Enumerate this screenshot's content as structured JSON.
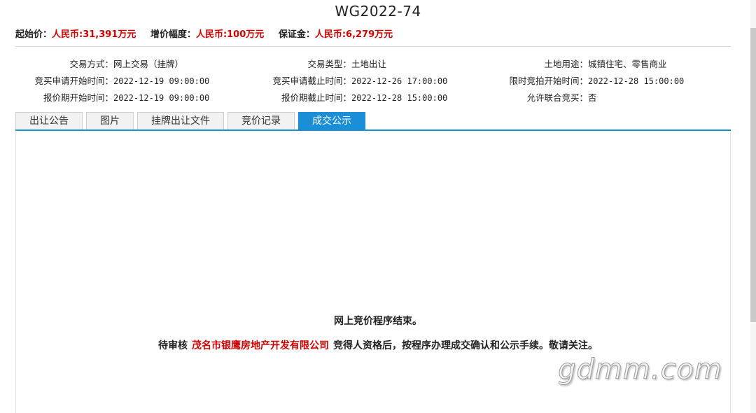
{
  "title": "WG2022-74",
  "price": {
    "start_label": "起始价：",
    "start_value": "人民币:31,391万元",
    "increment_label": "增价幅度：",
    "increment_value": "人民币:100万元",
    "deposit_label": "保证金：",
    "deposit_value": "人民币:6,279万元"
  },
  "info": {
    "col1": [
      {
        "k": "交易方式：",
        "v": "网上交易（挂牌）"
      },
      {
        "k": "竞买申请开始时间：",
        "v": "2022-12-19 09:00:00"
      },
      {
        "k": "报价期开始时间：",
        "v": "2022-12-19 09:00:00"
      }
    ],
    "col2": [
      {
        "k": "交易类型：",
        "v": "土地出让"
      },
      {
        "k": "竞买申请截止时间：",
        "v": "2022-12-26 17:00:00"
      },
      {
        "k": "报价期截止时间：",
        "v": "2022-12-28 15:00:00"
      }
    ],
    "col3": [
      {
        "k": "土地用途：",
        "v": "城镇住宅、零售商业"
      },
      {
        "k": "限时竞拍开始时间：",
        "v": "2022-12-28 15:00:00"
      },
      {
        "k": "允许联合竞买：",
        "v": "否"
      }
    ]
  },
  "tabs": [
    "出让公告",
    "图片",
    "挂牌出让文件",
    "竞价记录",
    "成交公示"
  ],
  "active_tab": "成交公示",
  "result": {
    "line1": "网上竞价程序结束。",
    "line2_prefix": "待审核",
    "company": "茂名市银鹰房地产开发有限公司",
    "line2_suffix": "竞得人资格后，按程序办理成交确认和公示手续。敬请关注。"
  },
  "watermark": "gdmm.com",
  "colors": {
    "accent": "#1a8fd8",
    "highlight": "#cc0000"
  }
}
